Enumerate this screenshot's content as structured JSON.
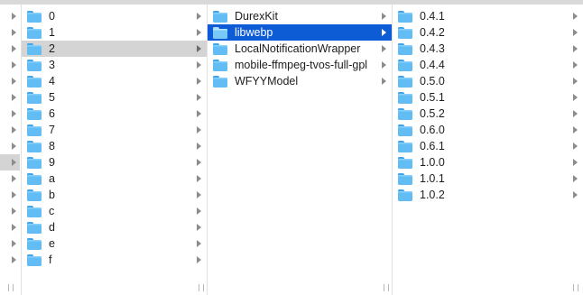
{
  "columns": [
    {
      "items": [
        "0",
        "1",
        "2",
        "3",
        "4",
        "5",
        "6",
        "7",
        "8",
        "9",
        "a",
        "b",
        "c",
        "d",
        "e",
        "f"
      ],
      "selected": 2
    },
    {
      "items": [
        "DurexKit",
        "libwebp",
        "LocalNotificationWrapper",
        "mobile-ffmpeg-tvos-full-gpl",
        "WFYYModel"
      ],
      "selected": 1
    },
    {
      "items": [
        "0.4.1",
        "0.4.2",
        "0.4.3",
        "0.4.4",
        "0.5.0",
        "0.5.1",
        "0.5.2",
        "0.6.0",
        "0.6.1",
        "1.0.0",
        "1.0.1",
        "1.0.2"
      ],
      "selected": -1
    }
  ],
  "left_strip": {
    "selected_row": 9
  },
  "colors": {
    "selection_active": "#0e5bd6",
    "selection_inactive": "#d4d4d4",
    "folder": "#62bdf5"
  },
  "icons": {
    "folder": "folder-icon",
    "disclosure": "disclosure-triangle-icon"
  }
}
